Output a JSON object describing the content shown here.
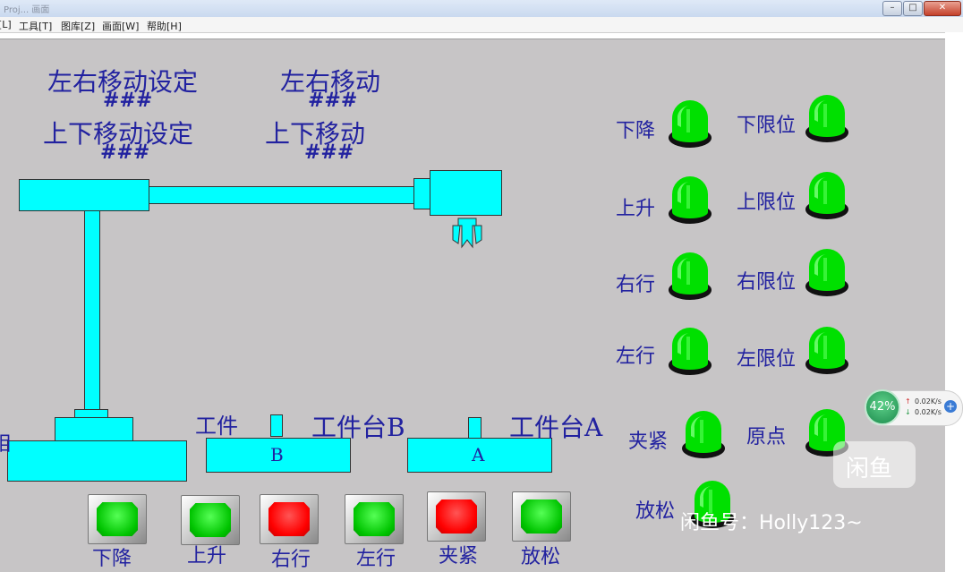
{
  "window": {
    "title": "Proj... 画面",
    "menu": [
      "[L]",
      "工具[T]",
      "图库[Z]",
      "画面[W]",
      "帮助[H]"
    ],
    "min_label": "–",
    "max_label": "□",
    "close_label": "✕"
  },
  "panel": {
    "lr_setting_label": "左右移动设定",
    "lr_setting_value": "###",
    "ud_setting_label": "上下移动设定",
    "ud_setting_value": "###",
    "lr_move_label": "左右移动",
    "lr_move_value": "###",
    "ud_move_label": "上下移动",
    "ud_move_value": "###",
    "workpiece_label": "工件",
    "table_b_label": "工件台B",
    "table_a_label": "工件台A",
    "table_b_letter": "B",
    "table_a_letter": "A",
    "edge_char": "相"
  },
  "lamps": [
    {
      "name": "lamp-descend",
      "label": "下降",
      "color": "green"
    },
    {
      "name": "lamp-lower-limit",
      "label": "下限位",
      "color": "green"
    },
    {
      "name": "lamp-ascend",
      "label": "上升",
      "color": "green"
    },
    {
      "name": "lamp-upper-limit",
      "label": "上限位",
      "color": "green"
    },
    {
      "name": "lamp-move-right",
      "label": "右行",
      "color": "green"
    },
    {
      "name": "lamp-right-limit",
      "label": "右限位",
      "color": "green"
    },
    {
      "name": "lamp-move-left",
      "label": "左行",
      "color": "green"
    },
    {
      "name": "lamp-left-limit",
      "label": "左限位",
      "color": "green"
    },
    {
      "name": "lamp-clamp",
      "label": "夹紧",
      "color": "green"
    },
    {
      "name": "lamp-origin",
      "label": "原点",
      "color": "green"
    },
    {
      "name": "lamp-release",
      "label": "放松",
      "color": "green"
    }
  ],
  "buttons": [
    {
      "name": "descend-button",
      "label": "下降",
      "color": "green"
    },
    {
      "name": "ascend-button",
      "label": "上升",
      "color": "green"
    },
    {
      "name": "move-right-button",
      "label": "右行",
      "color": "red"
    },
    {
      "name": "move-left-button",
      "label": "左行",
      "color": "green"
    },
    {
      "name": "clamp-button",
      "label": "夹紧",
      "color": "red"
    },
    {
      "name": "release-button",
      "label": "放松",
      "color": "green"
    }
  ],
  "overlay": {
    "net_percent": "42%",
    "upload_speed": "0.02K/s",
    "download_speed": "0.02K/s",
    "watermark_logo": "闲鱼",
    "watermark_text": "闲鱼号：Holly123~"
  },
  "colors": {
    "canvas": "#c7c5c6",
    "cyan": "#00ffff",
    "label_blue": "#2222a0",
    "lamp_green": "#00e000",
    "button_red": "#ff0000"
  }
}
